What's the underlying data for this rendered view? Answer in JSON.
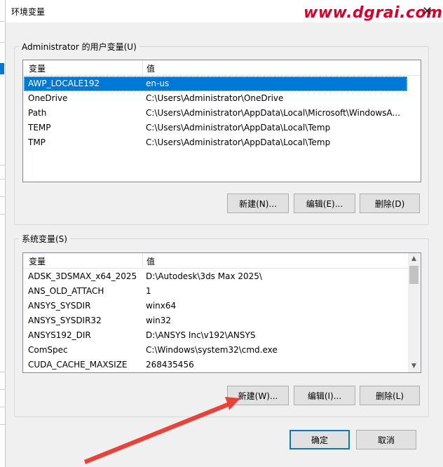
{
  "window": {
    "title": "环境变量",
    "watermark": "www.dgrai.com"
  },
  "user_vars": {
    "group_label": "Administrator 的用户变量(U)",
    "col_variable": "变量",
    "col_value": "值",
    "rows": [
      {
        "name": "AWP_LOCALE192",
        "value": "en-us",
        "selected": true
      },
      {
        "name": "OneDrive",
        "value": "C:\\Users\\Administrator\\OneDrive",
        "selected": false
      },
      {
        "name": "Path",
        "value": "C:\\Users\\Administrator\\AppData\\Local\\Microsoft\\WindowsA...",
        "selected": false
      },
      {
        "name": "TEMP",
        "value": "C:\\Users\\Administrator\\AppData\\Local\\Temp",
        "selected": false
      },
      {
        "name": "TMP",
        "value": "C:\\Users\\Administrator\\AppData\\Local\\Temp",
        "selected": false
      }
    ],
    "buttons": {
      "new": "新建(N)...",
      "edit": "编辑(E)...",
      "delete": "删除(D)"
    }
  },
  "system_vars": {
    "group_label": "系统变量(S)",
    "col_variable": "变量",
    "col_value": "值",
    "rows": [
      {
        "name": "ADSK_3DSMAX_x64_2025",
        "value": "D:\\Autodesk\\3ds Max 2025\\"
      },
      {
        "name": "ANS_OLD_ATTACH",
        "value": "1"
      },
      {
        "name": "ANSYS_SYSDIR",
        "value": "winx64"
      },
      {
        "name": "ANSYS_SYSDIR32",
        "value": "win32"
      },
      {
        "name": "ANSYS192_DIR",
        "value": "D:\\ANSYS Inc\\v192\\ANSYS"
      },
      {
        "name": "ComSpec",
        "value": "C:\\Windows\\system32\\cmd.exe"
      },
      {
        "name": "CUDA_CACHE_MAXSIZE",
        "value": "268435456"
      }
    ],
    "buttons": {
      "new": "新建(W)...",
      "edit": "编辑(I)...",
      "delete": "删除(L)"
    }
  },
  "footer": {
    "ok": "确定",
    "cancel": "取消"
  },
  "colors": {
    "selection": "#0078d7",
    "annotation_arrow": "#e8433a",
    "watermark": "#d9002c"
  },
  "icons": {
    "close": "close-icon",
    "scroll_up": "chevron-up-icon",
    "scroll_down": "chevron-down-icon"
  }
}
